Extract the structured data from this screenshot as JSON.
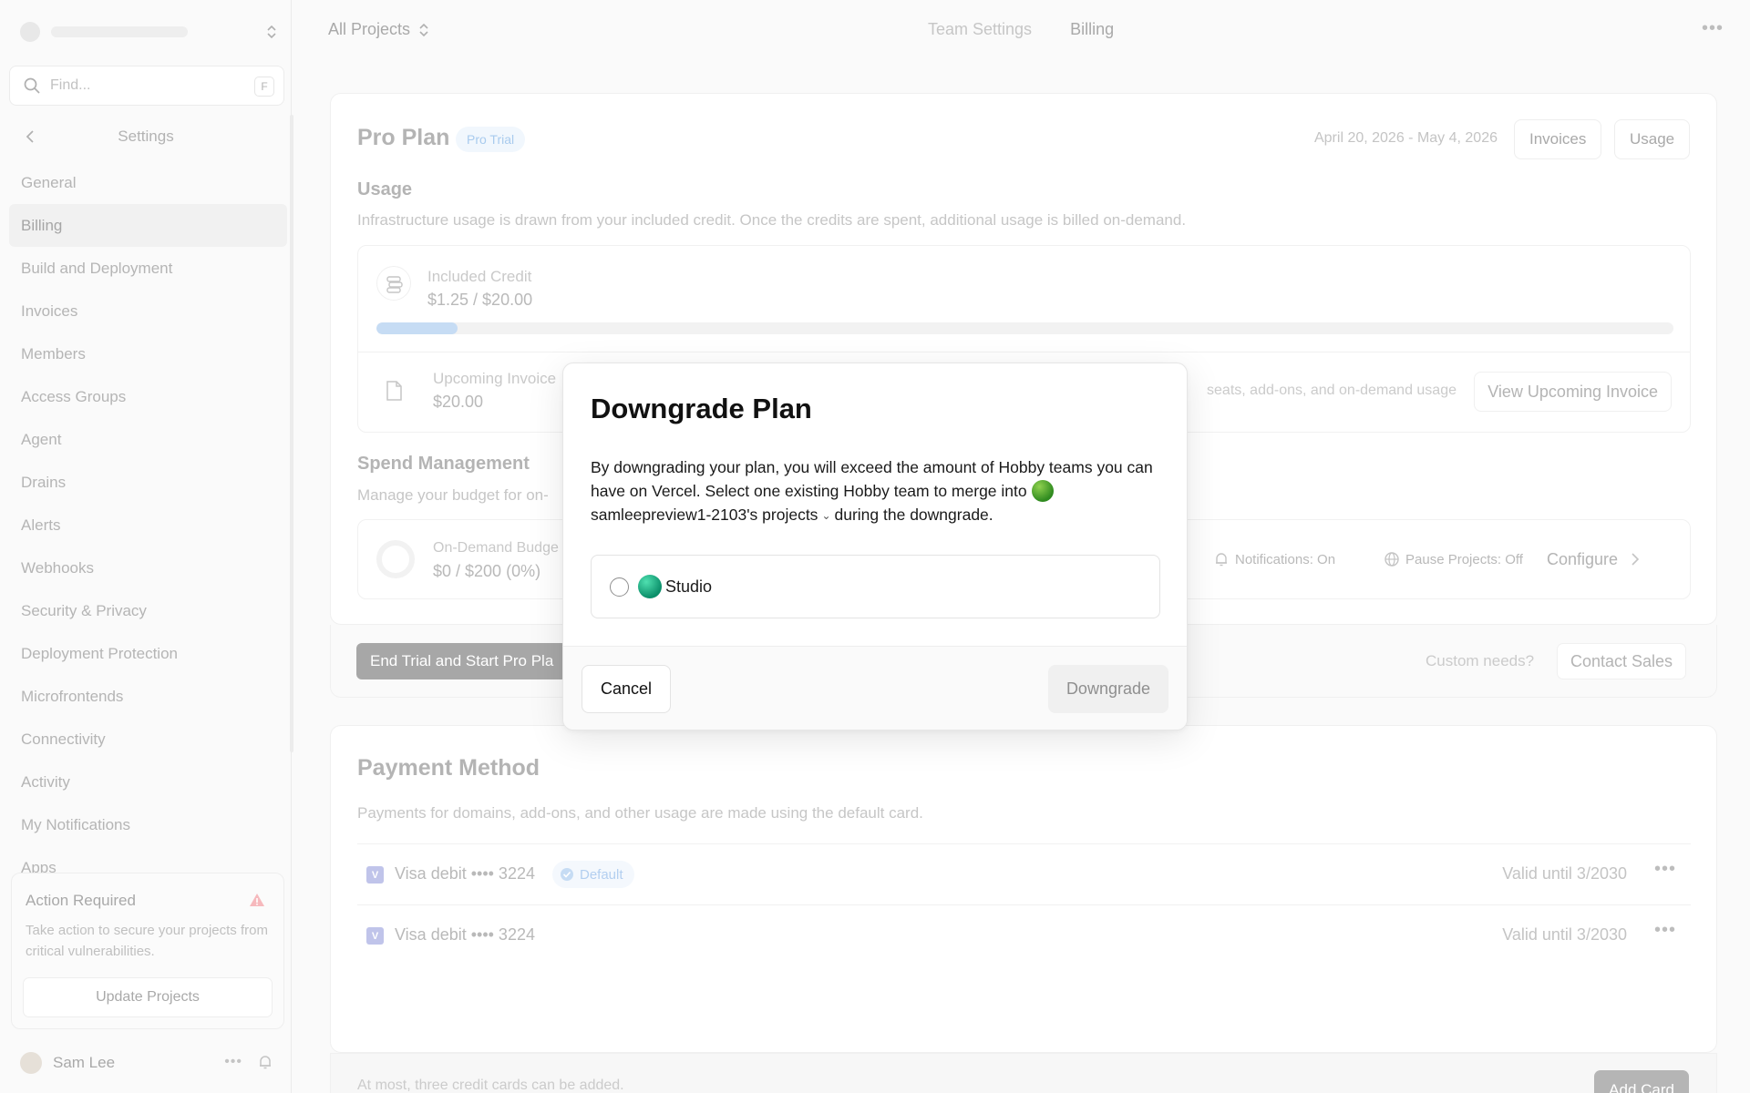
{
  "sidebar": {
    "search_placeholder": "Find...",
    "search_shortcut": "F",
    "settings_title": "Settings",
    "items": [
      {
        "label": "General"
      },
      {
        "label": "Billing",
        "active": true
      },
      {
        "label": "Build and Deployment"
      },
      {
        "label": "Invoices"
      },
      {
        "label": "Members"
      },
      {
        "label": "Access Groups"
      },
      {
        "label": "Agent"
      },
      {
        "label": "Drains"
      },
      {
        "label": "Alerts"
      },
      {
        "label": "Webhooks"
      },
      {
        "label": "Security & Privacy"
      },
      {
        "label": "Deployment Protection"
      },
      {
        "label": "Microfrontends"
      },
      {
        "label": "Connectivity"
      },
      {
        "label": "Activity"
      },
      {
        "label": "My Notifications"
      },
      {
        "label": "Apps"
      }
    ],
    "action_card": {
      "title": "Action Required",
      "text": "Take action to secure your projects from critical vulnerabilities.",
      "button": "Update Projects"
    },
    "user": {
      "name": "Sam Lee"
    }
  },
  "topbar": {
    "projects": "All Projects",
    "tabs": [
      {
        "label": "Team Settings"
      },
      {
        "label": "Billing",
        "active": true
      }
    ]
  },
  "plan": {
    "title": "Pro Plan",
    "badge": "Pro Trial",
    "date_range": "April 20, 2026 - May 4, 2026",
    "invoices_btn": "Invoices",
    "usage_btn": "Usage",
    "usage_title": "Usage",
    "usage_desc": "Infrastructure usage is drawn from your included credit. Once the credits are spent, additional usage is billed on-demand.",
    "credit_label": "Included Credit",
    "credit_value": "$1.25 / $20.00",
    "credit_progress": 0.0625,
    "upcoming_label": "Upcoming Invoice",
    "upcoming_value": "$20.00",
    "upcoming_note": "seats, add-ons, and on-demand usage",
    "view_upcoming_btn": "View Upcoming Invoice",
    "spend_title": "Spend Management",
    "spend_desc": "Manage your budget for on-",
    "ondemand_label": "On-Demand Budge",
    "ondemand_value": "$0 / $200 (0%)",
    "notifications": "Notifications: On",
    "pause_projects": "Pause Projects: Off",
    "configure_btn": "Configure",
    "trial_btn": "End Trial and Start Pro Pla",
    "custom_needs": "Custom needs?",
    "contact_btn": "Contact Sales"
  },
  "payment": {
    "title": "Payment Method",
    "desc": "Payments for domains, add-ons, and other usage are made using the default card.",
    "cards": [
      {
        "brand": "V",
        "label": "Visa debit •••• 3224",
        "badge": "Default",
        "valid": "Valid until 3/2030"
      },
      {
        "brand": "V",
        "label": "Visa debit •••• 3224",
        "valid": "Valid until 3/2030"
      }
    ],
    "note": "At most, three credit cards can be added.",
    "add_btn": "Add Card"
  },
  "modal": {
    "title": "Downgrade Plan",
    "text_before": "By downgrading your plan, you will exceed the amount of Hobby teams you can have on Vercel. Select one existing Hobby team to merge into",
    "account_name": "samleepreview1-2103's projects",
    "text_after": "during the downgrade.",
    "option": {
      "name": "Studio",
      "selected": false
    },
    "cancel_btn": "Cancel",
    "downgrade_btn": "Downgrade"
  }
}
